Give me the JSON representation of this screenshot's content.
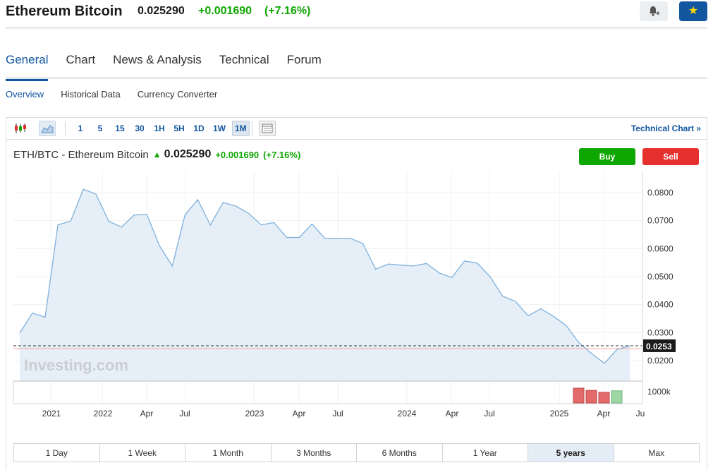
{
  "header": {
    "instrument_name": "Ethereum Bitcoin",
    "price": "0.025290",
    "change": "+0.001690",
    "change_pct": "(+7.16%)"
  },
  "main_tabs": [
    "General",
    "Chart",
    "News & Analysis",
    "Technical",
    "Forum"
  ],
  "sub_tabs": [
    "Overview",
    "Historical Data",
    "Currency Converter"
  ],
  "toolbar": {
    "timeframes": [
      "1",
      "5",
      "15",
      "30",
      "1H",
      "5H",
      "1D",
      "1W",
      "1M"
    ],
    "active_timeframe": "1M",
    "technical_link": "Technical Chart »"
  },
  "chart_header": {
    "symbol": "ETH/BTC - Ethereum Bitcoin",
    "price": "0.025290",
    "change": "+0.001690",
    "change_pct": "(+7.16%)",
    "buy_label": "Buy",
    "sell_label": "Sell"
  },
  "watermark": "Investing.com",
  "colors": {
    "accent": "#1256a0",
    "up": "#0ea600",
    "down": "#e5302e",
    "line": "#7fb0dc",
    "fill": "#e6eff7"
  },
  "chart_data": {
    "type": "area",
    "title": "ETH/BTC - Ethereum Bitcoin",
    "x_labels": [
      "2021",
      "2022",
      "Apr",
      "Jul",
      "2023",
      "Apr",
      "Jul",
      "2024",
      "Apr",
      "Jul",
      "2025",
      "Apr",
      "Ju"
    ],
    "y_ticks": [
      "0.0800",
      "0.0700",
      "0.0600",
      "0.0500",
      "0.0400",
      "0.0300",
      "0.0200"
    ],
    "ylim": [
      0.0163,
      0.0875
    ],
    "current_value_label": "0.0253",
    "current_value": 0.0253,
    "series": [
      {
        "values": [
          0.0298,
          0.037,
          0.0355,
          0.0685,
          0.0698,
          0.0812,
          0.0795,
          0.0698,
          0.0677,
          0.072,
          0.0722,
          0.061,
          0.0538,
          0.072,
          0.0775,
          0.0684,
          0.0765,
          0.0752,
          0.0726,
          0.0685,
          0.0693,
          0.064,
          0.064,
          0.0688,
          0.0637,
          0.0637,
          0.0637,
          0.0618,
          0.0527,
          0.0545,
          0.0541,
          0.0538,
          0.0547,
          0.0513,
          0.0497,
          0.0556,
          0.0548,
          0.05,
          0.043,
          0.0412,
          0.036,
          0.0385,
          0.0358,
          0.0325,
          0.0264,
          0.0225,
          0.019,
          0.024,
          0.0253
        ]
      }
    ],
    "volume_label": "1000k",
    "volume_bars": [
      {
        "value": 1.0,
        "direction": "down"
      },
      {
        "value": 0.85,
        "direction": "down"
      },
      {
        "value": 0.72,
        "direction": "down"
      },
      {
        "value": 0.82,
        "direction": "up"
      }
    ],
    "grid": true
  },
  "ranges": [
    "1 Day",
    "1 Week",
    "1 Month",
    "3 Months",
    "6 Months",
    "1 Year",
    "5 years",
    "Max"
  ],
  "active_range": "5 years"
}
